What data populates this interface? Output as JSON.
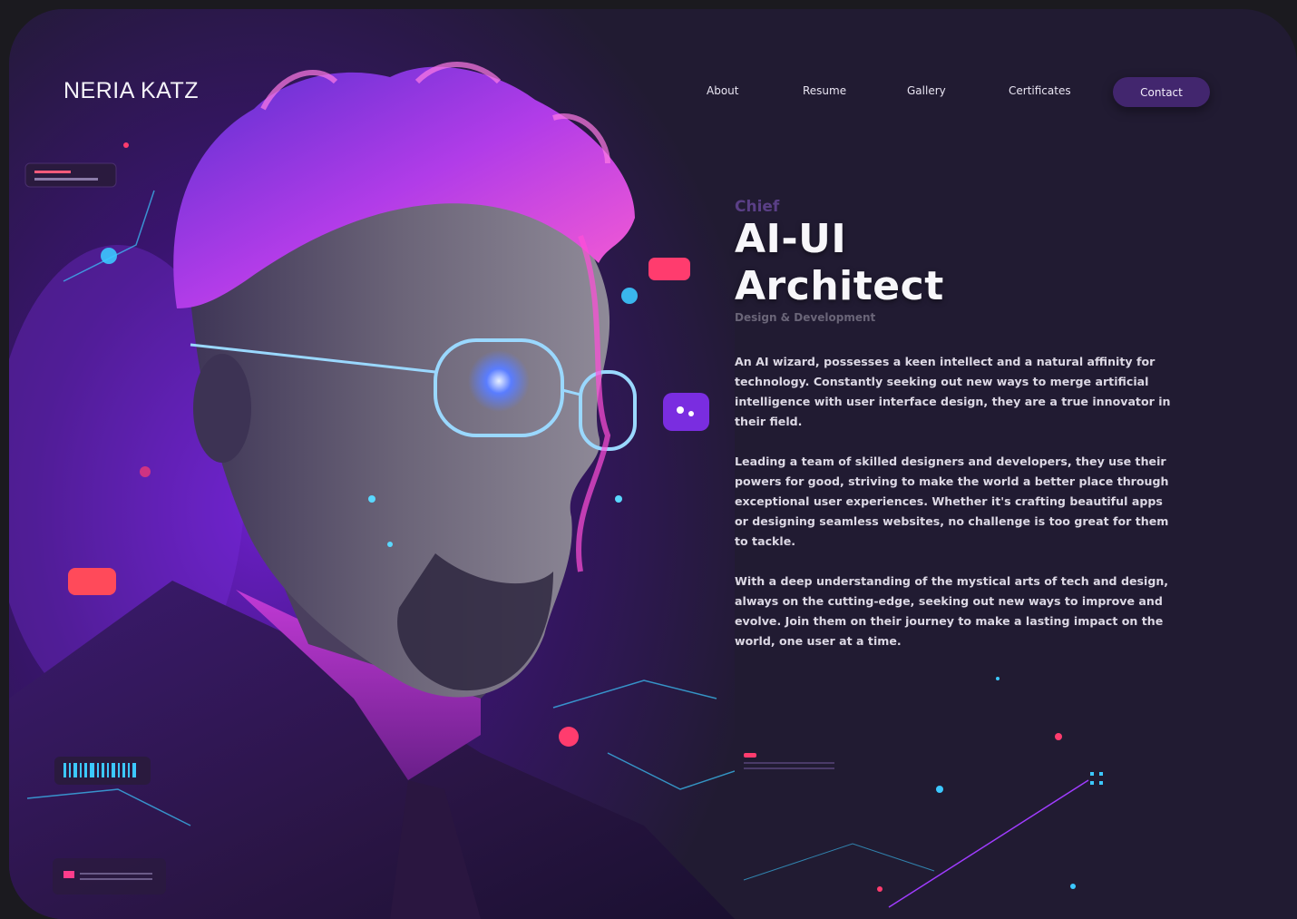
{
  "brand": {
    "name": "NERIA KATZ"
  },
  "nav": {
    "items": [
      {
        "label": "About"
      },
      {
        "label": "Resume"
      },
      {
        "label": "Gallery"
      },
      {
        "label": "Certificates"
      }
    ],
    "cta_label": "Contact"
  },
  "hero": {
    "eyebrow": "Chief",
    "title_line1": "AI-UI",
    "title_line2": "Architect",
    "subtitle": "Design & Development",
    "paragraphs": [
      "An AI wizard, possesses a keen intellect and a natural affinity for technology. Constantly seeking out new ways to merge artificial intelligence with user interface design, they are a true innovator in their field.",
      "Leading a team of skilled designers and developers, they use their powers for good, striving to make the world a better place through exceptional user experiences. Whether it's crafting beautiful apps or designing seamless websites, no challenge is too great for them to tackle.",
      "With a deep understanding of the mystical arts of tech and design, always on the cutting-edge, seeking out new ways to improve and evolve. Join them on their journey to make a lasting impact on the world, one user at a time."
    ]
  },
  "colors": {
    "background": "#211b32",
    "accent": "#42266e",
    "neon_purple": "#a03cff",
    "neon_blue": "#3cc8ff",
    "neon_pink": "#ff3c8c"
  },
  "icons": [
    "portrait-illustration",
    "glasses-icon",
    "chip-icon",
    "barcode-icon"
  ]
}
